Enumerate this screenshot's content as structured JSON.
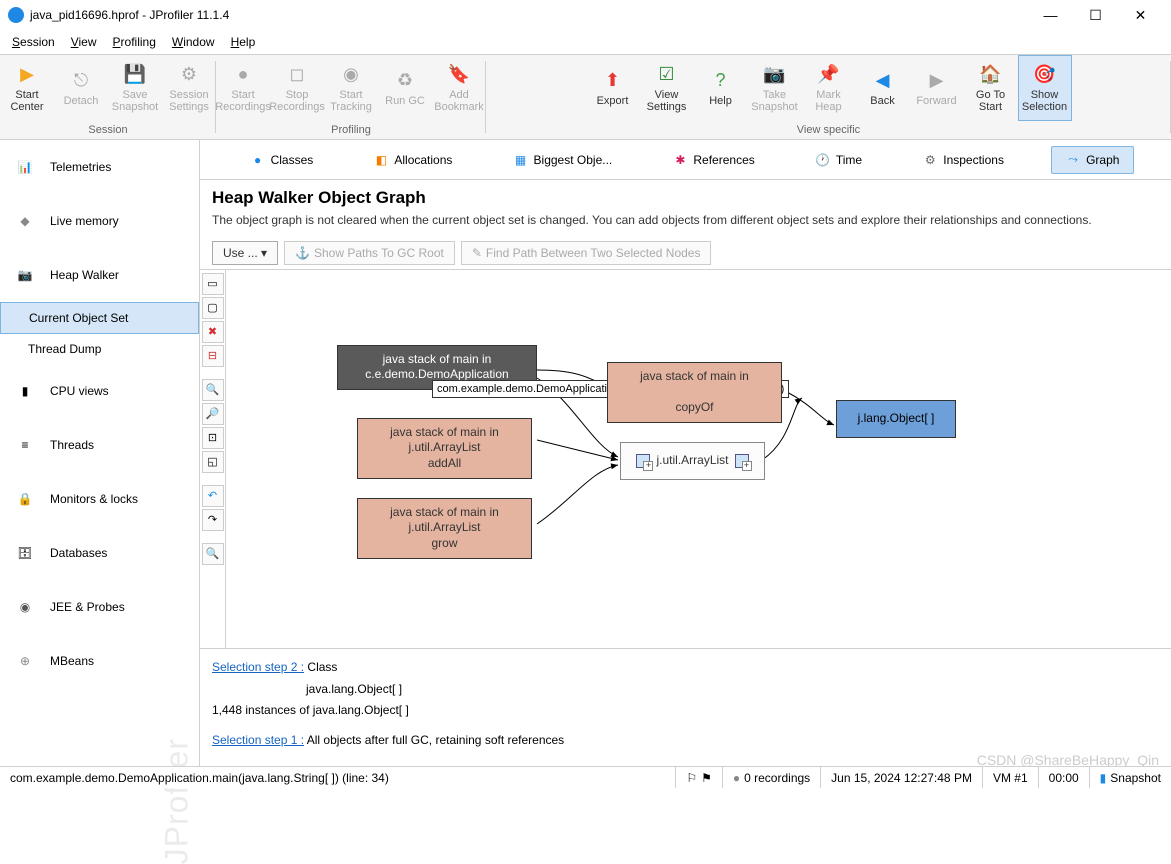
{
  "window": {
    "title": "java_pid16696.hprof - JProfiler 11.1.4"
  },
  "menu": {
    "session": "Session",
    "view": "View",
    "profiling": "Profiling",
    "window": "Window",
    "help": "Help"
  },
  "toolbar_groups": {
    "session": {
      "label": "Session",
      "start_center": "Start\nCenter",
      "detach": "Detach",
      "save_snapshot": "Save\nSnapshot",
      "session_settings": "Session\nSettings"
    },
    "profiling": {
      "label": "Profiling",
      "start_recordings": "Start\nRecordings",
      "stop_recordings": "Stop\nRecordings",
      "start_tracking": "Start\nTracking",
      "run_gc": "Run GC",
      "add_bookmark": "Add\nBookmark"
    },
    "view_specific": {
      "label": "View specific",
      "export": "Export",
      "view_settings": "View\nSettings",
      "help": "Help",
      "take_snapshot": "Take\nSnapshot",
      "mark_heap": "Mark\nHeap",
      "back": "Back",
      "forward": "Forward",
      "goto_start": "Go To\nStart",
      "show_selection": "Show\nSelection"
    }
  },
  "sidebar": {
    "telemetries": "Telemetries",
    "live_memory": "Live memory",
    "heap_walker": "Heap Walker",
    "current_object_set": "Current Object Set",
    "thread_dump": "Thread Dump",
    "cpu_views": "CPU views",
    "threads": "Threads",
    "monitors_locks": "Monitors & locks",
    "databases": "Databases",
    "jee_probes": "JEE & Probes",
    "mbeans": "MBeans",
    "watermark": "JProfiler"
  },
  "tabs": {
    "classes": "Classes",
    "allocations": "Allocations",
    "biggest": "Biggest Obje...",
    "references": "References",
    "time": "Time",
    "inspections": "Inspections",
    "graph": "Graph"
  },
  "header": {
    "title": "Heap Walker Object Graph",
    "desc": "The object graph is not cleared when the current object set is changed. You can add objects from different object sets and explore their relationships and connections."
  },
  "actions": {
    "use": "Use ... ▾",
    "show_paths": "Show Paths To GC Root",
    "find_path": "Find Path Between Two Selected Nodes"
  },
  "nodes": {
    "n1_l1": "java stack of main in",
    "n1_l2": "c.e.demo.DemoApplication",
    "tooltip": "com.example.demo.DemoApplication.main(java.lang.String[ ]) (line: 34)",
    "n2_l1": "java stack of main in",
    "n2_l2": "j.util.ArrayList",
    "n2_l3": "addAll",
    "n3_l1": "java stack of main in",
    "n3_l2": "j.util.ArrayList",
    "n3_l3": "grow",
    "n4_l1": "java stack of main in",
    "n4_l3": "copyOf",
    "n5": "j.util.ArrayList",
    "n6": "j.lang.Object[ ]"
  },
  "selection": {
    "step2_label": "Selection step 2 :",
    "step2_text": " Class",
    "step2_sub": "java.lang.Object[ ]",
    "instances": "1,448 instances of java.lang.Object[ ]",
    "step1_label": "Selection step 1 :",
    "step1_text": " All objects after full GC, retaining soft references"
  },
  "statusbar": {
    "path": "com.example.demo.DemoApplication.main(java.lang.String[ ]) (line: 34)",
    "recordings": "0 recordings",
    "datetime": "Jun 15, 2024 12:27:48 PM",
    "vm": "VM #1",
    "elapsed": "00:00",
    "snapshot": "Snapshot"
  },
  "watermark": "CSDN @ShareBeHappy_Qin"
}
